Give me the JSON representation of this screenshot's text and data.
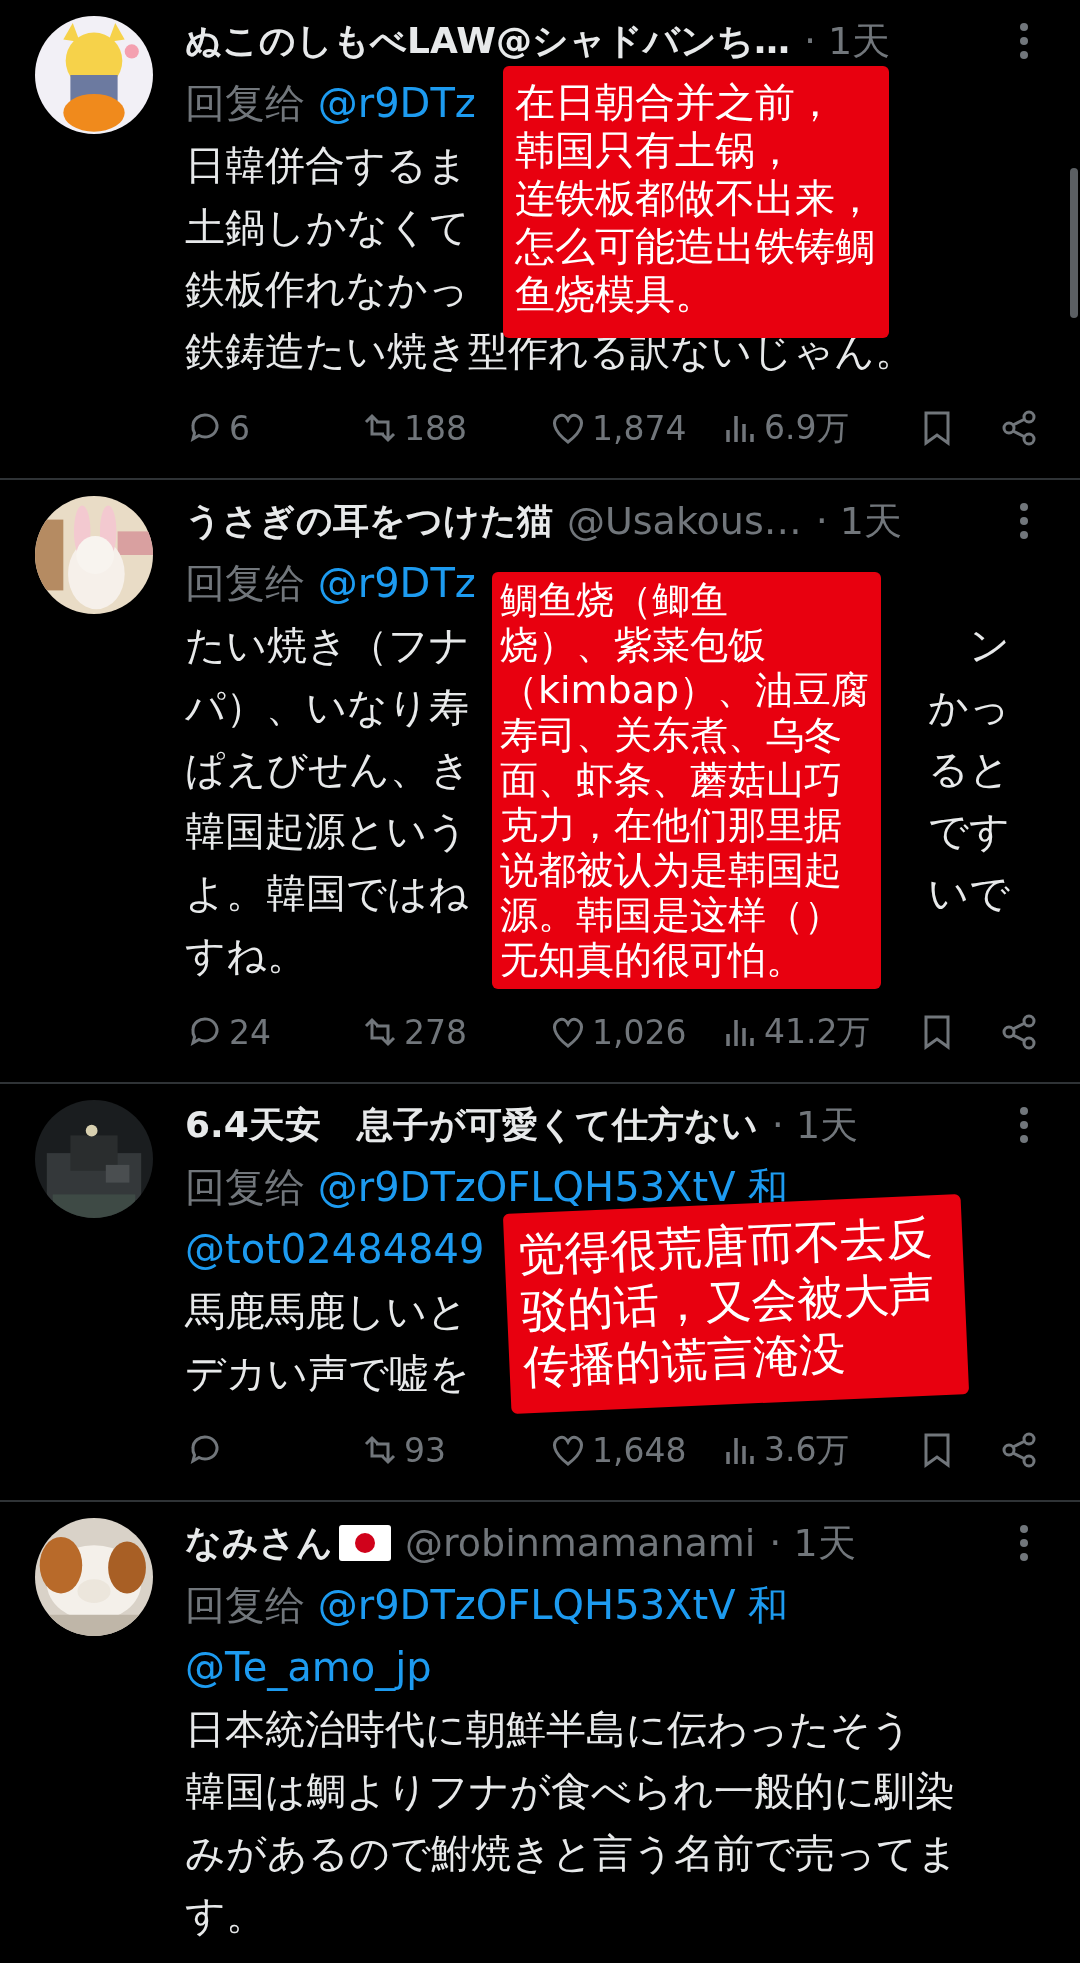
{
  "tweets": [
    {
      "author": "ぬこのしもべLAW@シャドバンち…",
      "time": "· 1天",
      "avatar": {
        "kind": "picture"
      },
      "reply": [
        {
          "kind": "label",
          "text": "回复给"
        },
        {
          "kind": "mention",
          "text": "@r9DTz"
        }
      ],
      "body": [
        {
          "left": "日韓併合するま"
        },
        {
          "left": "土鍋しかなくて"
        },
        {
          "left": "鉄板作れなかっ"
        },
        {
          "left": "鉄鋳造たい焼き型作れる訳ないじゃん。"
        }
      ],
      "note": {
        "kind": "flat",
        "lines": [
          "在日朝合并之前，",
          "韩国只有土锅，",
          "连铁板都做不出来，",
          "怎么可能造出铁铸鲷",
          "鱼烧模具。"
        ]
      },
      "metrics": [
        {
          "kind": "reply",
          "count": "6"
        },
        {
          "kind": "retweet",
          "count": "188"
        },
        {
          "kind": "like",
          "count": "1,874"
        },
        {
          "kind": "views",
          "count": "6.9万"
        },
        {
          "kind": "bookmark"
        },
        {
          "kind": "share"
        }
      ]
    },
    {
      "author": "うさぎの耳をつけた猫",
      "handle": "@Usakous…",
      "time": "· 1天",
      "avatar": {
        "kind": "picture"
      },
      "reply": [
        {
          "kind": "label",
          "text": "回复给"
        },
        {
          "kind": "mention",
          "text": "@r9DTz"
        }
      ],
      "body": [
        {
          "left": "たい焼き（フナ",
          "right": "ン"
        },
        {
          "left": "パ）、いなり寿",
          "right": "かっ"
        },
        {
          "left": "ぱえびせん、き",
          "right": "ると"
        },
        {
          "left": "韓国起源という",
          "right": "です"
        },
        {
          "left": "よ。韓国ではね",
          "right": "いで"
        },
        {
          "left": "すね。"
        }
      ],
      "note": {
        "kind": "flat",
        "lines": [
          "鲷鱼烧（鲫鱼",
          "烧）、紫菜包饭",
          "（kimbap）、油豆腐",
          "寿司、关东煮、乌冬",
          "面、虾条、蘑菇山巧",
          "克力，在他们那里据",
          "说都被认为是韩国起",
          "源。韩国是这样（）",
          "无知真的很可怕。"
        ]
      },
      "metrics": [
        {
          "kind": "reply",
          "count": "24"
        },
        {
          "kind": "retweet",
          "count": "278"
        },
        {
          "kind": "like",
          "count": "1,026"
        },
        {
          "kind": "views",
          "count": "41.2万"
        },
        {
          "kind": "bookmark"
        },
        {
          "kind": "share"
        }
      ]
    },
    {
      "author": "6.4天安　息子が可愛くて仕方ない",
      "time": "· 1天",
      "avatar": {
        "kind": "picture"
      },
      "reply": [
        {
          "kind": "label",
          "text": "回复给"
        },
        {
          "kind": "mention",
          "text": "@r9DTzOFLQH53XtV"
        },
        {
          "kind": "plain",
          "text": "和"
        },
        {
          "kind": "mention",
          "text": "@tot02484849"
        }
      ],
      "body": [
        {
          "left": "馬鹿馬鹿しいと"
        },
        {
          "left": "デカい声で嘘を"
        }
      ],
      "note": {
        "kind": "tilted",
        "lines": [
          "觉得很荒唐而不去反",
          "驳的话，又会被大声",
          "传播的谎言淹没"
        ]
      },
      "metrics": [
        {
          "kind": "reply"
        },
        {
          "kind": "retweet",
          "count": "93"
        },
        {
          "kind": "like",
          "count": "1,648"
        },
        {
          "kind": "views",
          "count": "3.6万"
        },
        {
          "kind": "bookmark"
        },
        {
          "kind": "share"
        }
      ]
    },
    {
      "author": "なみさん",
      "flag": true,
      "handle": "@robinmamanami",
      "time": "· 1天",
      "avatar": {
        "kind": "picture"
      },
      "reply": [
        {
          "kind": "label",
          "text": "回复给"
        },
        {
          "kind": "mention",
          "text": "@r9DTzOFLQH53XtV"
        },
        {
          "kind": "plain",
          "text": "和"
        },
        {
          "kind": "mention",
          "text": "@Te_amo_jp"
        }
      ],
      "paragraphs": [
        "日本統治時代に朝鮮半島に伝わったそう",
        "韓国は鯛よりフナが食べられ一般的に馴染みがあるので鮒焼きと言う名前で売ってます。"
      ]
    }
  ]
}
